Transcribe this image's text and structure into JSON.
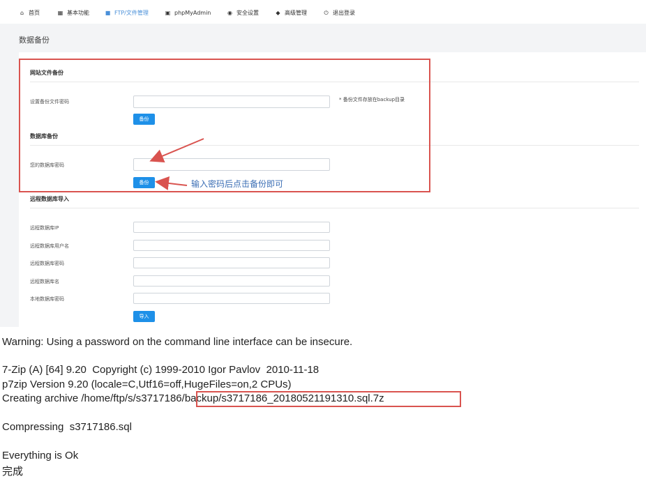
{
  "nav": {
    "items": [
      {
        "label": "首页",
        "icon": "home-icon"
      },
      {
        "label": "基本功能",
        "icon": "grid-icon"
      },
      {
        "label": "FTP/文件管理",
        "icon": "folder-icon",
        "active": true
      },
      {
        "label": "phpMyAdmin",
        "icon": "database-icon"
      },
      {
        "label": "安全设置",
        "icon": "shield-icon"
      },
      {
        "label": "高级管理",
        "icon": "layers-icon"
      },
      {
        "label": "退出登录",
        "icon": "power-icon"
      }
    ]
  },
  "page": {
    "title": "数据备份"
  },
  "site_backup": {
    "title": "网站文件备份",
    "password_label": "设置备份文件密码",
    "password_value": "",
    "hint": "* 备份文件存放在backup目录",
    "button": "备份"
  },
  "db_backup": {
    "title": "数据库备份",
    "password_label": "您的数据库密码",
    "password_value": "",
    "button": "备份"
  },
  "annotation": {
    "text": "输入密码后点击备份即可"
  },
  "remote_import": {
    "title": "远程数据库导入",
    "fields": [
      {
        "label": "远程数据库IP",
        "value": ""
      },
      {
        "label": "远程数据库用户名",
        "value": ""
      },
      {
        "label": "远程数据库密码",
        "value": ""
      },
      {
        "label": "远程数据库名",
        "value": ""
      },
      {
        "label": "本地数据库密码",
        "value": ""
      }
    ],
    "button": "导入"
  },
  "console": {
    "line1": "Warning: Using a password on the command line interface can be insecure.",
    "line2": "7-Zip (A) [64] 9.20  Copyright (c) 1999-2010 Igor Pavlov  2010-11-18",
    "line3": "p7zip Version 9.20 (locale=C,Utf16=off,HugeFiles=on,2 CPUs)",
    "line4_prefix": "Creating archive /home/ftp/s/s3717186",
    "line4_path": "/backup/s3717186_20180521191310.sql.7z",
    "line5": "Compressing  s3717186.sql",
    "line6": "Everything is Ok",
    "line7": "完成"
  },
  "colors": {
    "accent": "#1e90e8",
    "highlight_box": "#d9534f",
    "annotation": "#3c6fb5"
  }
}
